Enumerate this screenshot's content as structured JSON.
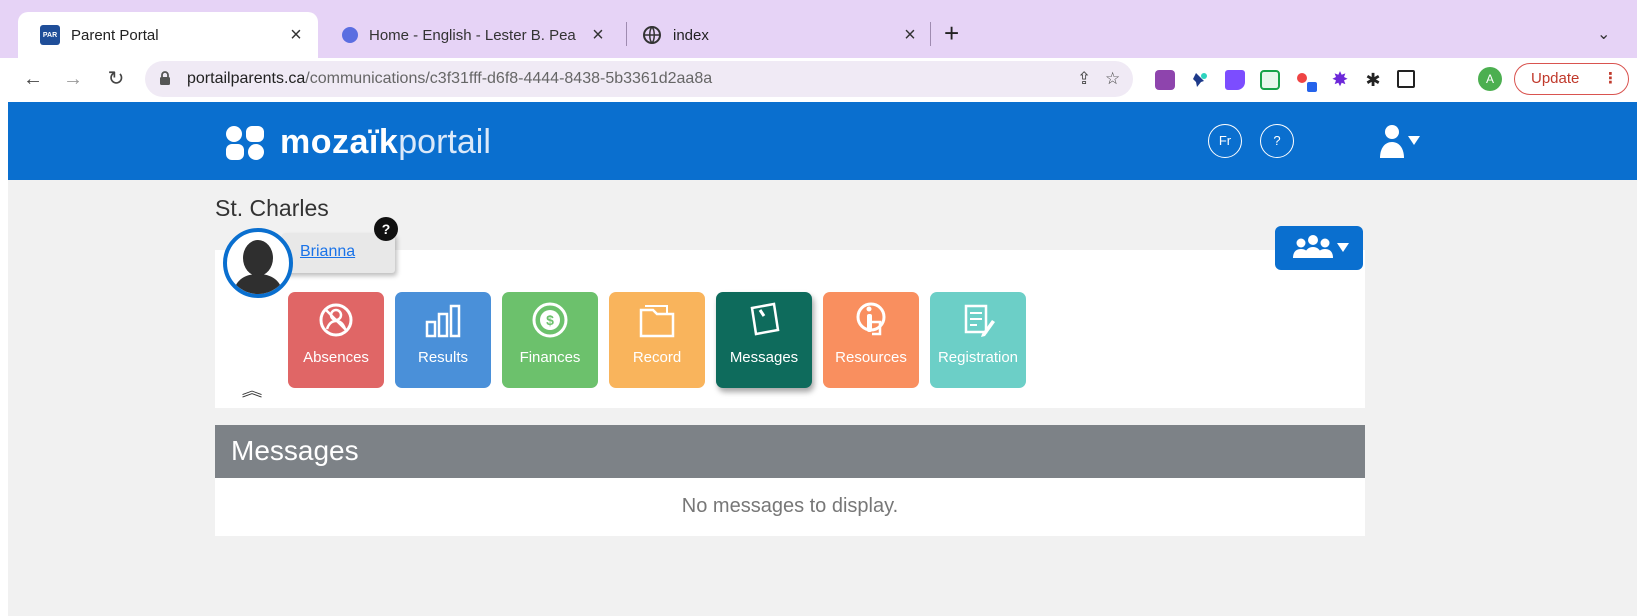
{
  "browser": {
    "tabs": [
      {
        "title": "Parent Portal",
        "favicon": "PAR",
        "active": true
      },
      {
        "title": "Home - English - Lester B. Pea",
        "active": false
      },
      {
        "title": "index",
        "active": false
      }
    ],
    "url_host": "portailparents.ca",
    "url_path": "/communications/c3f31fff-d6f8-4444-8438-5b3361d2aa8a",
    "profile_initial": "A",
    "update_label": "Update"
  },
  "portal": {
    "logo_bold": "mozaïk",
    "logo_light": "portail",
    "lang_label": "Fr",
    "help_label": "?"
  },
  "school": "St. Charles",
  "student": {
    "name": "Brianna",
    "help_badge": "?"
  },
  "tiles": [
    {
      "label": "Absences",
      "icon": "absences-icon",
      "color": "#e06666"
    },
    {
      "label": "Results",
      "icon": "results-chart-icon",
      "color": "#4a90d9"
    },
    {
      "label": "Finances",
      "icon": "dollar-coin-icon",
      "color": "#6cc16c"
    },
    {
      "label": "Record",
      "icon": "folder-icon",
      "color": "#f9b45c"
    },
    {
      "label": "Messages",
      "icon": "message-note-icon",
      "color": "#0e6b5c"
    },
    {
      "label": "Resources",
      "icon": "resources-icon",
      "color": "#f98f5f"
    },
    {
      "label": "Registration",
      "icon": "registration-form-icon",
      "color": "#6ccfc7"
    }
  ],
  "messages": {
    "heading": "Messages",
    "empty_text": "No messages to display."
  }
}
